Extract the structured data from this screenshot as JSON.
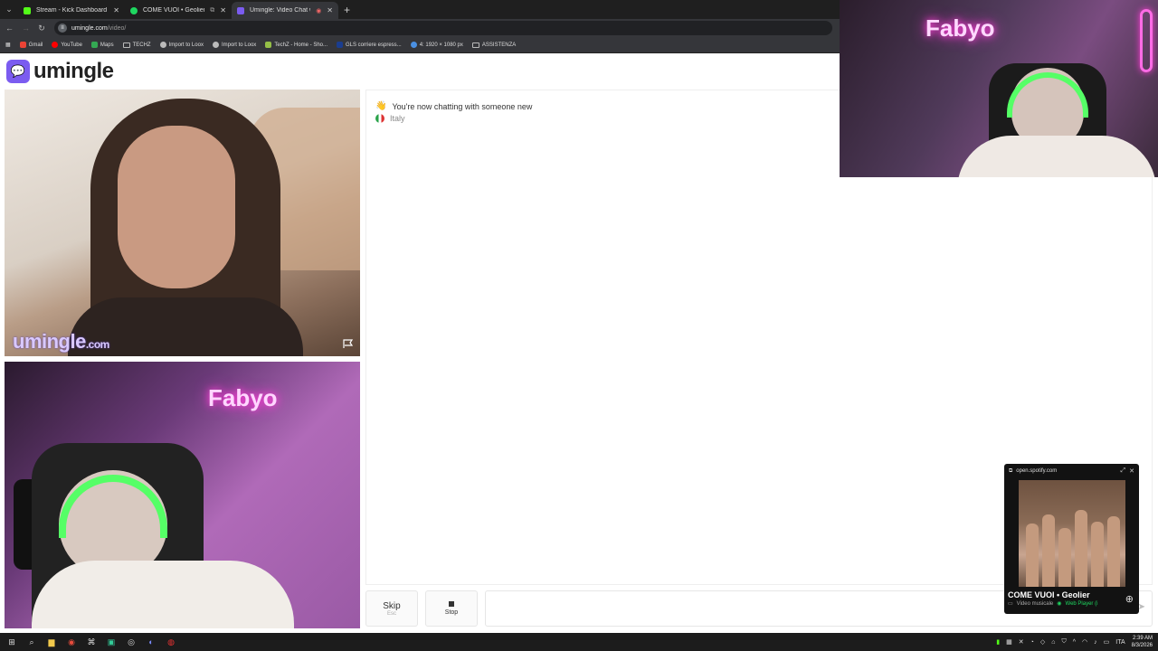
{
  "browser": {
    "tabs": [
      {
        "label": "Stream - Kick Dashboard",
        "color": "#53fc18"
      },
      {
        "label": "COME VUOI • Geolier",
        "color": "#1ed760"
      },
      {
        "label": "Umingle: Video Chat with S",
        "color": "#7b5cf0"
      }
    ],
    "url_host": "umingle.com",
    "url_path": "/video/",
    "bookmarks": [
      {
        "label": "Gmail",
        "color": "#ea4335"
      },
      {
        "label": "YouTube",
        "color": "#ff0000"
      },
      {
        "label": "Maps",
        "color": "#34a853"
      },
      {
        "label": "TECHZ",
        "folder": true
      },
      {
        "label": "Import to Loox",
        "color": "#bbb"
      },
      {
        "label": "Import to Loox",
        "color": "#bbb"
      },
      {
        "label": "TechZ - Home - Sho...",
        "color": "#95bf47"
      },
      {
        "label": "GLS corriere espress...",
        "color": "#1a3d8f"
      },
      {
        "label": "4: 1920 × 1080 px",
        "color": "#4a90e2"
      },
      {
        "label": "ASSISTENZA",
        "folder": true
      }
    ]
  },
  "site": {
    "logo_text": "umingle",
    "watermark": "umingle",
    "watermark_tld": ".com",
    "neon_text": "Fabyo"
  },
  "chat": {
    "system_message": "You're now chatting with someone new",
    "country": "Italy",
    "input_placeholder": ""
  },
  "controls": {
    "skip_label": "Skip",
    "skip_hint": "Esc",
    "stop_label": "Stop"
  },
  "spotify": {
    "host": "open.spotify.com",
    "title": "COME VUOI • Geolier",
    "meta": "Video musicale",
    "player": "Web Player (i"
  },
  "taskbar": {
    "time": "2:39 AM",
    "date": "8/3/2026",
    "lang": "ITA"
  }
}
